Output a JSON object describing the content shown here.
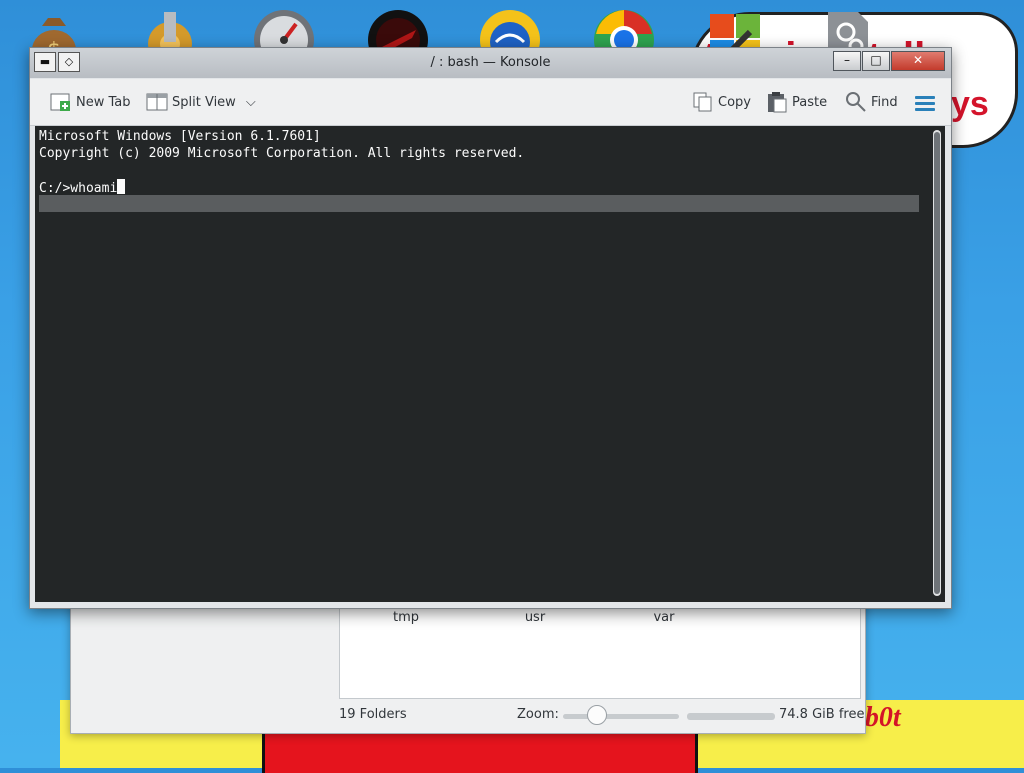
{
  "desktop": {
    "dock_icons": [
      "money-bag-icon",
      "gear-plugin-icon",
      "speedometer-icon",
      "red-disc-icon",
      "globe-sun-icon",
      "chrome-browser-icon",
      "windows-link-icon"
    ],
    "bubble_text": "this is totally",
    "bubble_text_end": "ys",
    "signature": "r00b0t"
  },
  "konsole": {
    "title": "/ : bash — Konsole",
    "toolbar": {
      "new_tab": "New Tab",
      "split_view": "Split View",
      "copy": "Copy",
      "paste": "Paste",
      "find": "Find"
    },
    "terminal_lines": [
      "Microsoft Windows [Version 6.1.7601]",
      "Copyright (c) 2009 Microsoft Corporation. All rights reserved.",
      "",
      "C:/>whoami"
    ]
  },
  "file_manager": {
    "folders": [
      "tmp",
      "usr",
      "var"
    ],
    "status_folders": "19 Folders",
    "zoom_label": "Zoom:",
    "free_space": "74.8 GiB free"
  },
  "colors": {
    "terminal_bg": "#232627",
    "terminal_fg": "#fcfcfc",
    "accent": "#2980b9",
    "desktop_blue": "#3aa0e6"
  }
}
